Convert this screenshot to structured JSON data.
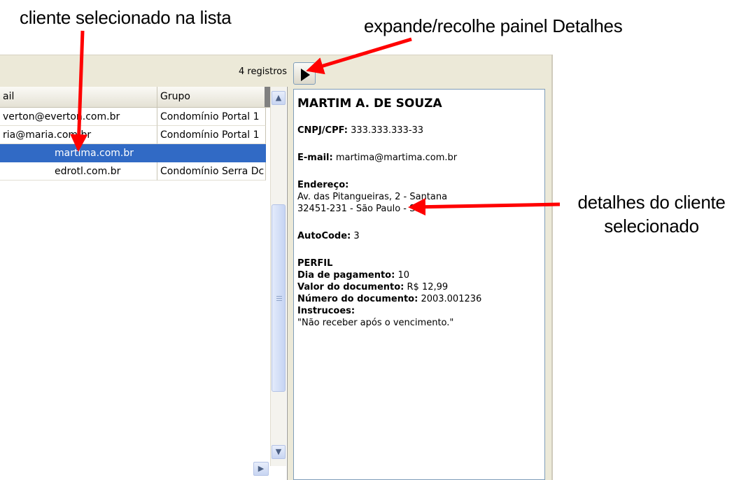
{
  "annotations": {
    "selected_client": "cliente selecionado na lista",
    "expand_panel": "expande/recolhe painel Detalhes",
    "client_details_line1": "detalhes do cliente",
    "client_details_line2": "selecionado"
  },
  "toolbar": {
    "record_count": "4 registros",
    "toggle_icon": "play-triangle-icon"
  },
  "grid": {
    "columns": [
      {
        "label": "ail"
      },
      {
        "label": "Grupo"
      }
    ],
    "rows": [
      {
        "email": "verton@everton.com.br",
        "group": "Condomínio Portal 1",
        "selected": false
      },
      {
        "email": "ria@maria.com.br",
        "group": "Condomínio Portal 1",
        "selected": false
      },
      {
        "email": "martima.com.br",
        "group": "",
        "selected": true
      },
      {
        "email": "edrotl.com.br",
        "group": "Condomínio Serra Dc",
        "selected": false
      }
    ]
  },
  "details": {
    "name": "MARTIM A. DE SOUZA",
    "cpf_label": "CNPJ/CPF:",
    "cpf_value": "333.333.333-33",
    "email_label": "E-mail:",
    "email_value": "martima@martima.com.br",
    "address_label": "Endereço:",
    "address_line1": "Av. das Pitangueiras, 2 - Santana",
    "address_line2": "32451-231 - São Paulo - SP",
    "autocode_label": "AutoCode:",
    "autocode_value": "3",
    "profile_label": "PERFIL",
    "pay_day_label": "Dia de pagamento:",
    "pay_day_value": "10",
    "doc_value_label": "Valor do documento:",
    "doc_value_value": "R$ 12,99",
    "doc_number_label": "Número do documento:",
    "doc_number_value": "2003.001236",
    "instructions_label": "Instrucoes:",
    "instructions_value": "\"Não receber após o vencimento.\""
  },
  "colors": {
    "selection": "#316ac5",
    "arrow": "#ff0000",
    "window_bg": "#ece9d8"
  }
}
